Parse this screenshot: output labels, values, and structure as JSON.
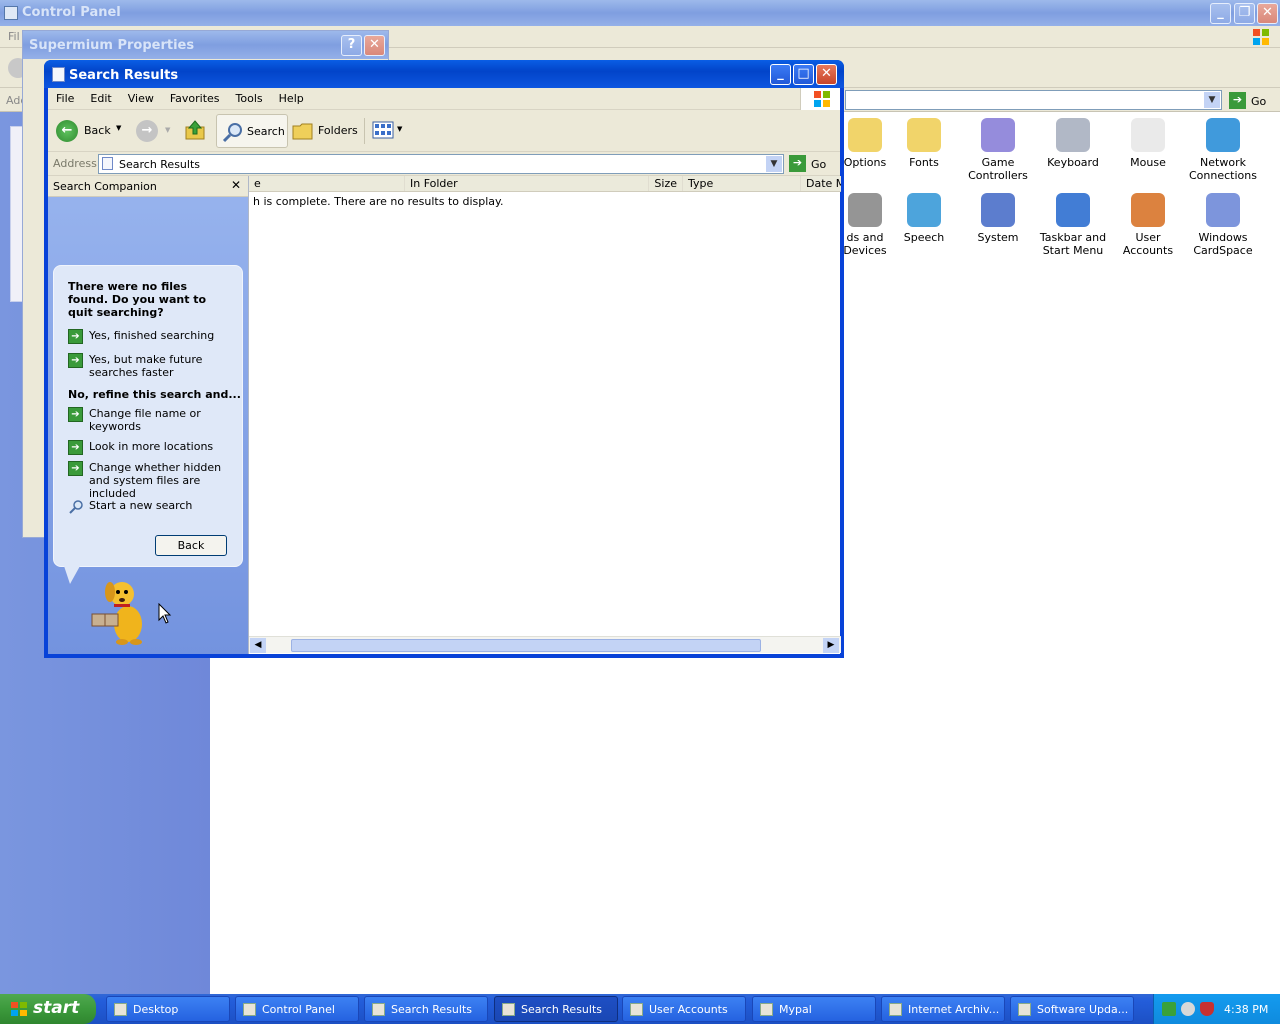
{
  "control_panel": {
    "title": "Control Panel",
    "menu_partial": "Fil",
    "address_partial": "Add",
    "go_label": "Go",
    "icons": [
      {
        "label": "Options",
        "icon": "folder-options-icon"
      },
      {
        "label": "Fonts",
        "icon": "fonts-folder-icon"
      },
      {
        "label": "Game Controllers",
        "icon": "gamepad-icon"
      },
      {
        "label": "Keyboard",
        "icon": "keyboard-icon"
      },
      {
        "label": "Mouse",
        "icon": "mouse-icon"
      },
      {
        "label": "Network Connections",
        "icon": "network-globe-icon"
      },
      {
        "label": "ds and Devices",
        "icon": "speaker-icon"
      },
      {
        "label": "Speech",
        "icon": "speech-icon"
      },
      {
        "label": "System",
        "icon": "system-computer-icon"
      },
      {
        "label": "Taskbar and Start Menu",
        "icon": "taskbar-icon"
      },
      {
        "label": "User Accounts",
        "icon": "users-icon"
      },
      {
        "label": "Windows CardSpace",
        "icon": "cardspace-icon"
      }
    ]
  },
  "supermium": {
    "title": "Supermium Properties",
    "help_button": "?",
    "close_button": "✕"
  },
  "search_window": {
    "title": "Search Results",
    "menu": [
      "File",
      "Edit",
      "View",
      "Favorites",
      "Tools",
      "Help"
    ],
    "toolbar": {
      "back": "Back",
      "search": "Search",
      "folders": "Folders"
    },
    "address": {
      "label": "Address",
      "value": "Search Results",
      "go": "Go"
    },
    "companion": {
      "header": "Search Companion",
      "close": "✕",
      "question": "There were no files found. Do you want to quit searching?",
      "option1": "Yes, finished searching",
      "option2": "Yes, but make future searches faster",
      "refine_heading": "No, refine this search and...",
      "refine1": "Change file name or keywords",
      "refine2": "Look in more locations",
      "refine3": "Change whether hidden and system files are included",
      "new_search": "Start a new search",
      "back_button": "Back"
    },
    "columns": [
      "e",
      "In Folder",
      "Size",
      "Type",
      "Date M"
    ],
    "status_message": "h is complete. There are no results to display."
  },
  "taskbar": {
    "start": "start",
    "tasks": [
      {
        "label": "Desktop",
        "active": false
      },
      {
        "label": "Control Panel",
        "active": false
      },
      {
        "label": "Search Results",
        "active": false
      },
      {
        "label": "Search Results",
        "active": true
      },
      {
        "label": "User Accounts",
        "active": false
      },
      {
        "label": "Mypal",
        "active": false
      },
      {
        "label": "Internet Archiv...",
        "active": false
      },
      {
        "label": "Software Upda...",
        "active": false
      }
    ],
    "clock": "4:38 PM"
  },
  "colors": {
    "xp_blue": "#0a5ee5",
    "taskbar_blue": "#245edb",
    "start_green": "#3c9a3c",
    "companion_bg": "#7d9bde",
    "tray_blue": "#0f8bde"
  }
}
